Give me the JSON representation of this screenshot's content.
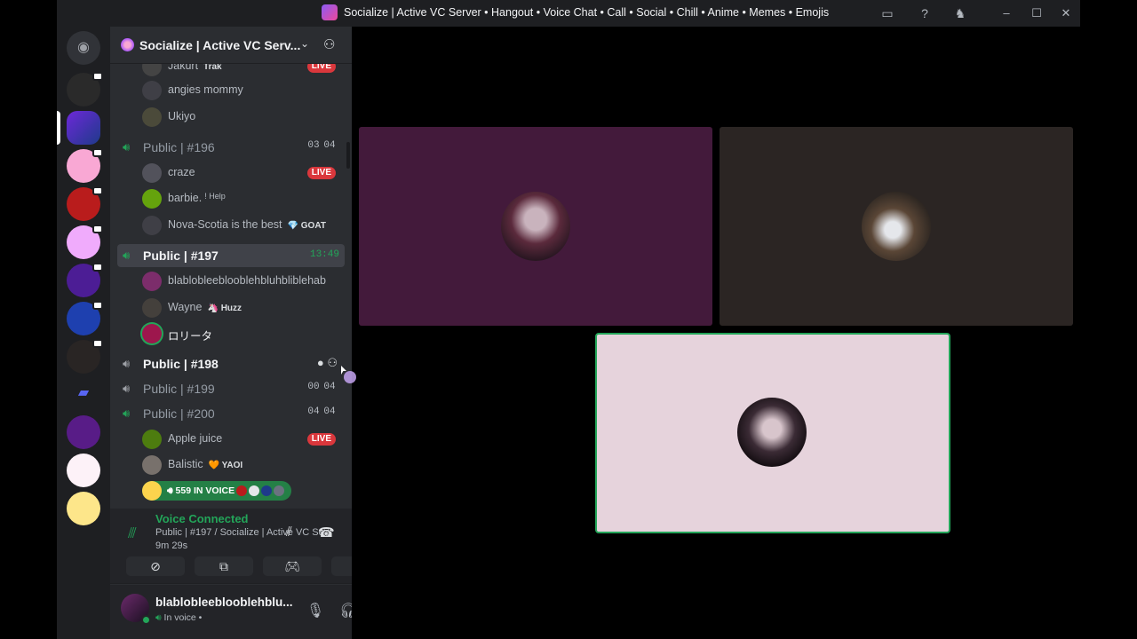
{
  "window": {
    "title": "Socialize | Active VC Server • Hangout • Voice Chat • Call • Social • Chill • Anime • Memes • Emojis"
  },
  "server": {
    "name": "Socialize | Active VC Serv..."
  },
  "channels": [
    {
      "name": "Public | #196",
      "count_a": "03",
      "count_b": "04"
    },
    {
      "name": "Public | #197",
      "timer": "13:49"
    },
    {
      "name": "Public | #198"
    },
    {
      "name": "Public | #199",
      "count_a": "00",
      "count_b": "04"
    },
    {
      "name": "Public | #200",
      "count_a": "04",
      "count_b": "04"
    }
  ],
  "members": {
    "top_partial": {
      "name": "Jakurt",
      "tag": "Trak",
      "live": "LIVE"
    },
    "angies": {
      "name": "angies mommy"
    },
    "ukiyo": {
      "name": "Ukiyo"
    },
    "craze": {
      "name": "craze",
      "live": "LIVE"
    },
    "barbie": {
      "name": "barbie.",
      "tag": "! Help"
    },
    "nova": {
      "name": "Nova-Scotia is the best",
      "tag": "GOAT"
    },
    "blab": {
      "name": "blablobleeblooblehbluhbliblehab"
    },
    "wayne": {
      "name": "Wayne",
      "tag": "Huzz"
    },
    "rolita": {
      "name": "ロリータ"
    },
    "apple": {
      "name": "Apple juice",
      "live": "LIVE"
    },
    "balistic": {
      "name": "Balistic",
      "tag": "YAOI"
    }
  },
  "in_voice": {
    "label": "559 IN VOICE"
  },
  "voice_panel": {
    "title": "Voice Connected",
    "channel": "Public | #197 / Socialize | Active VC Se...",
    "time": "9m 29s"
  },
  "user": {
    "name": "blablobleeblooblehblu...",
    "status": "In voice •"
  },
  "colors": {
    "accent_green": "#23a559",
    "live_red": "#da373c",
    "tile1": "#431a3b",
    "tile2": "#2b2523",
    "tile3": "#e6d3dc"
  }
}
